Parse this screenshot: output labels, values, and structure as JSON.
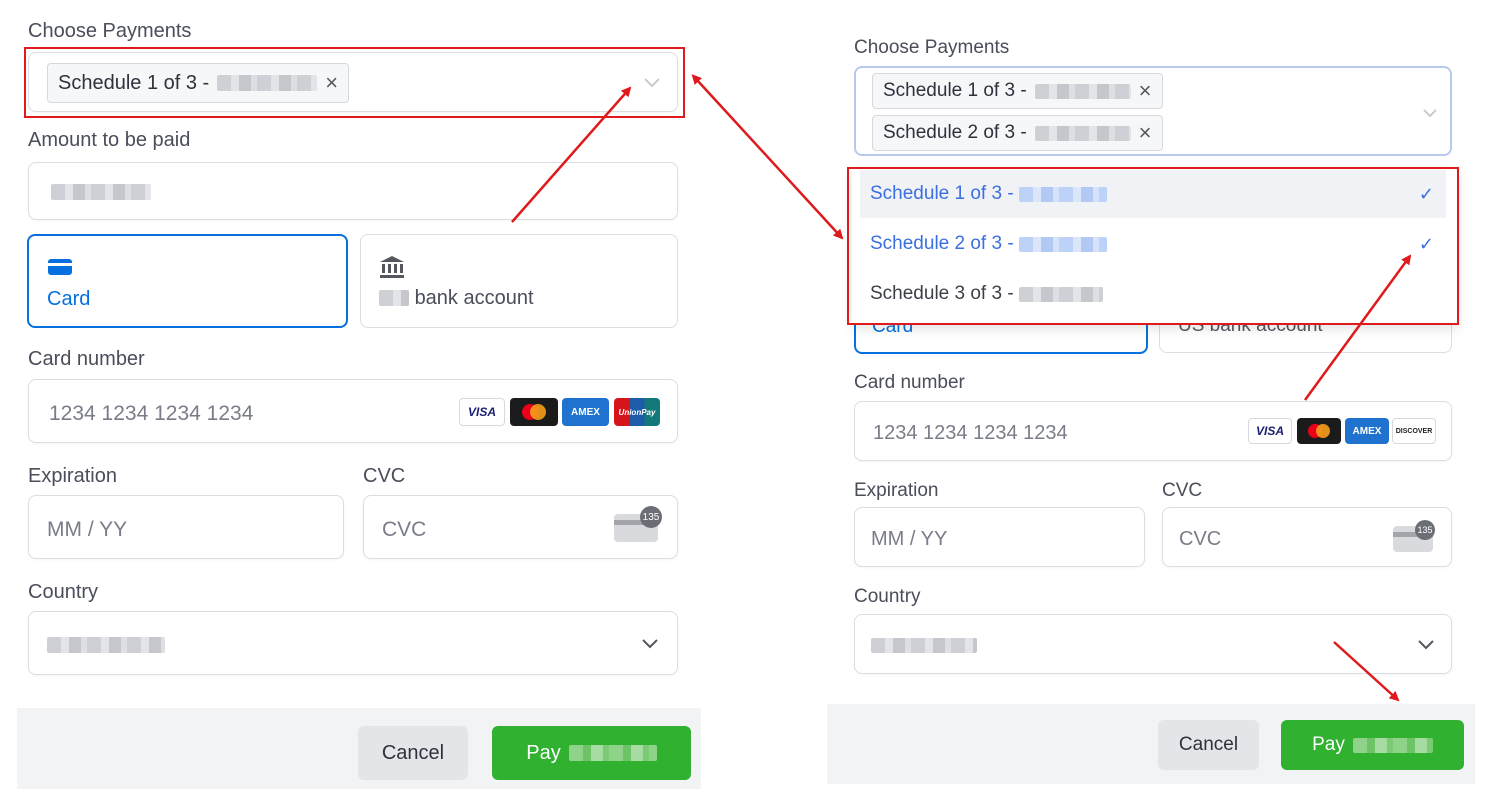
{
  "left": {
    "choose_payments_label": "Choose Payments",
    "selected_chip": "Schedule 1 of 3 -",
    "amount_label": "Amount to be paid",
    "tabs": [
      {
        "label": "Card",
        "icon": "card-icon",
        "active": true
      },
      {
        "label": "bank account",
        "icon": "bank-icon",
        "active": false
      }
    ],
    "card_number_label": "Card number",
    "card_number_placeholder": "1234 1234 1234 1234",
    "card_brands": [
      "VISA",
      "mastercard",
      "AMEX",
      "UnionPay"
    ],
    "expiration_label": "Expiration",
    "expiration_placeholder": "MM / YY",
    "cvc_label": "CVC",
    "cvc_placeholder": "CVC",
    "country_label": "Country",
    "cancel_label": "Cancel",
    "pay_label": "Pay"
  },
  "right": {
    "choose_payments_label": "Choose Payments",
    "selected_chips": [
      "Schedule 1 of 3 -",
      "Schedule 2 of 3 -"
    ],
    "dropdown_options": [
      {
        "label": "Schedule 1 of 3 -",
        "selected": true
      },
      {
        "label": "Schedule 2 of 3 -",
        "selected": true
      },
      {
        "label": "Schedule 3 of 3 -",
        "selected": false
      }
    ],
    "hidden_tab_labels": [
      "Card",
      "US bank account"
    ],
    "card_number_label": "Card number",
    "card_number_placeholder": "1234 1234 1234 1234",
    "card_brands": [
      "VISA",
      "mastercard",
      "AMEX",
      "DISCOVER"
    ],
    "expiration_label": "Expiration",
    "expiration_placeholder": "MM / YY",
    "cvc_label": "CVC",
    "cvc_placeholder": "CVC",
    "country_label": "Country",
    "cancel_label": "Cancel",
    "pay_label": "Pay"
  },
  "cvc_badge": "135",
  "colors": {
    "accent": "#0570de",
    "pay": "#30b12f",
    "annotation": "#e0191c",
    "option_selected": "#3b6fe0"
  }
}
